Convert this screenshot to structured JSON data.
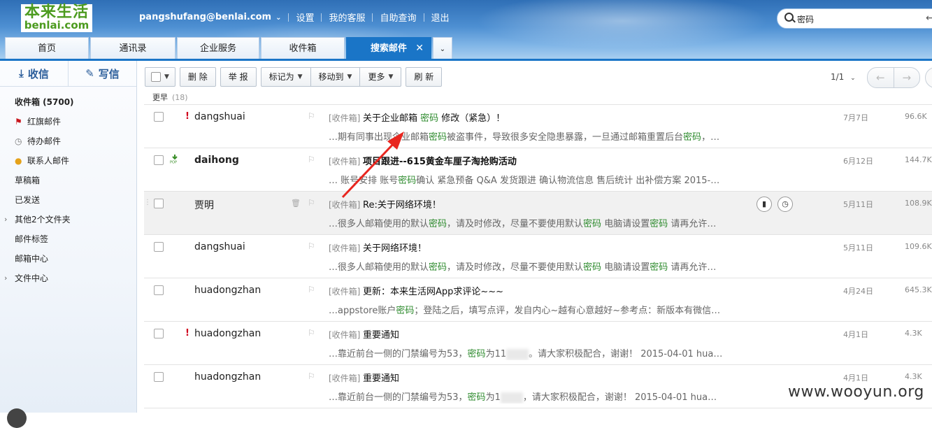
{
  "brand": {
    "logo_line1": "本来生活",
    "logo_line2": "benlai.com"
  },
  "topnav": {
    "account": "pangshufang@benlai.com",
    "links": [
      "设置",
      "我的客服",
      "自助查询",
      "退出"
    ]
  },
  "search": {
    "value": "密码"
  },
  "tabs": [
    "首页",
    "通讯录",
    "企业服务",
    "收件箱",
    "搜索邮件"
  ],
  "sidebar": {
    "receive": "收信",
    "compose": "写信",
    "folders": [
      "收件箱 (5700)",
      "红旗邮件",
      "待办邮件",
      "联系人邮件",
      "草稿箱",
      "已发送",
      "其他2个文件夹",
      "邮件标签",
      "邮箱中心",
      "文件中心"
    ]
  },
  "toolbar": {
    "delete": "删 除",
    "report": "举 报",
    "mark_as": "标记为",
    "move_to": "移动到",
    "more": "更多",
    "refresh": "刷 新",
    "page": "1/1"
  },
  "group": {
    "title": "更早",
    "count": "(18)"
  },
  "emails": [
    {
      "from": "dangshuai",
      "folder": "[收件箱]",
      "subject": "关于企业邮箱 密码 修改（紧急）！",
      "s1": "…期有同事出现企业邮箱",
      "s2": "密码",
      "s3": "被盗事件，导致很多安全隐患暴露，一旦通过邮箱重置后台",
      "s4": "密码",
      "s5": "，…",
      "date": "7月7日",
      "size": "96.6K"
    },
    {
      "from": "daihong",
      "folder": "[收件箱]",
      "subject": "项目跟进--615黄金车厘子淘抢购活动",
      "s1": "… 账号安排 账号",
      "s2": "密码",
      "s3": "确认 紧急预备 Q&A 发货跟进 确认物流信息 售后统计 出补偿方案 2015-…",
      "s4": "",
      "s5": "",
      "date": "6月12日",
      "size": "144.7K"
    },
    {
      "from": "贾明",
      "folder": "[收件箱]",
      "subject": "Re:关于网络环境！",
      "s1": "…很多人邮箱使用的默认",
      "s2": "密码",
      "s3": "，请及时修改，尽量不要使用默认",
      "s4": "密码",
      "s5": " 电脑请设置密码 请再允许…",
      "date": "5月11日",
      "size": "108.9K"
    },
    {
      "from": "dangshuai",
      "folder": "[收件箱]",
      "subject": "关于网络环境！",
      "s1": "…很多人邮箱使用的默认",
      "s2": "密码",
      "s3": "，请及时修改，尽量不要使用默认",
      "s4": "密码",
      "s5": " 电脑请设置密码 请再允许…",
      "date": "5月11日",
      "size": "109.6K"
    },
    {
      "from": "huadongzhan",
      "folder": "[收件箱]",
      "subject": "更新：本来生活网App求评论~~~",
      "s1": "…appstore账户",
      "s2": "密码",
      "s3": "；登陆之后，填写点评，发自内心~越有心意越好~参考点：新版本有微信…",
      "s4": "",
      "s5": "",
      "date": "4月24日",
      "size": "645.3K"
    },
    {
      "from": "huadongzhan",
      "folder": "[收件箱]",
      "subject": "重要通知",
      "s1": "…靠近前台一侧的门禁编号为53，",
      "s2": "密码",
      "s3": "为11",
      "s4": "",
      "s5": "。请大家积极配合，谢谢！ 2015-04-01 hua…",
      "date": "4月1日",
      "size": "4.3K"
    },
    {
      "from": "huadongzhan",
      "folder": "[收件箱]",
      "subject": "重要通知",
      "s1": "…靠近前台一侧的门禁编号为53，",
      "s2": "密码",
      "s3": "为1",
      "s4": "",
      "s5": "，请大家积极配合，谢谢！ 2015-04-01 hua…",
      "date": "4月1日",
      "size": "4.3K"
    }
  ],
  "watermark": "www.wooyun.org",
  "colors": {
    "brand_green": "#4c9b1f",
    "tab_active": "#1a75c7",
    "highlight": "#2e8b2e",
    "important": "#d0021b"
  }
}
